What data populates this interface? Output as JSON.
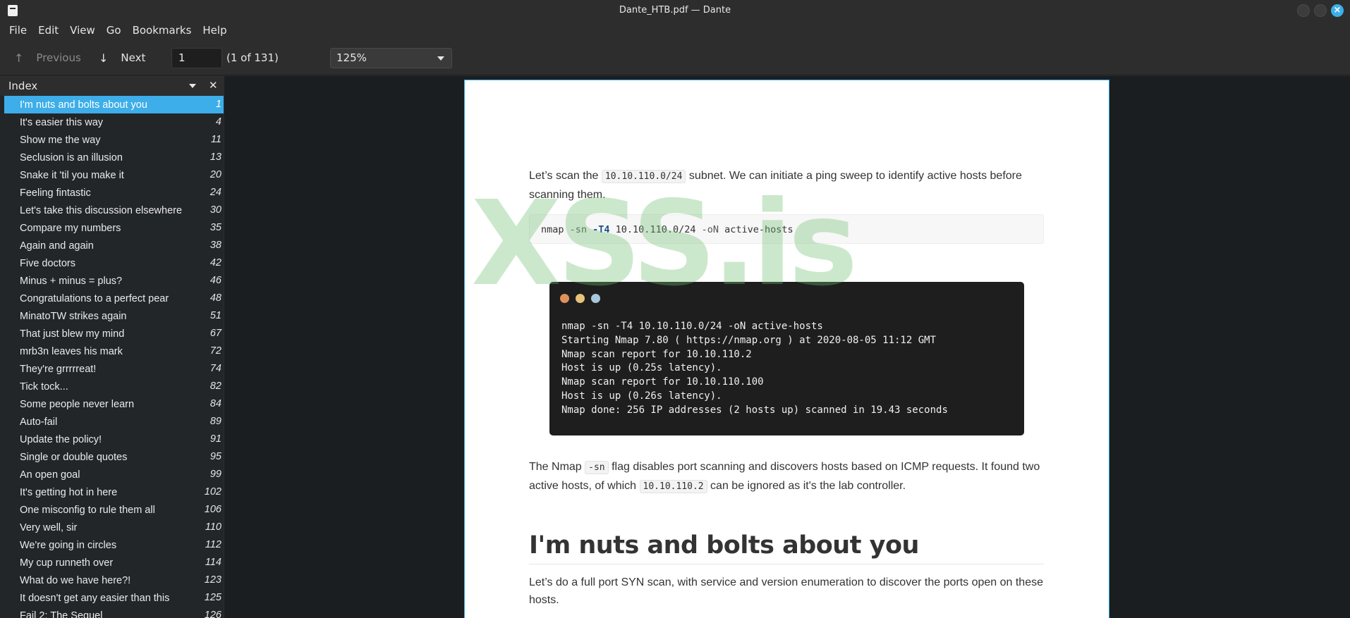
{
  "window": {
    "title": "Dante_HTB.pdf — Dante"
  },
  "menubar": {
    "items": [
      "File",
      "Edit",
      "View",
      "Go",
      "Bookmarks",
      "Help"
    ]
  },
  "toolbar": {
    "previous_label": "Previous",
    "next_label": "Next",
    "page_value": "1",
    "page_count": "(1 of 131)",
    "zoom_value": "125%"
  },
  "sidebar": {
    "title": "Index",
    "items": [
      {
        "label": "I'm nuts and bolts about you",
        "page": "1"
      },
      {
        "label": "It's easier this way",
        "page": "4"
      },
      {
        "label": "Show me the way",
        "page": "11"
      },
      {
        "label": "Seclusion is an illusion",
        "page": "13"
      },
      {
        "label": "Snake it 'til you make it",
        "page": "20"
      },
      {
        "label": "Feeling fintastic",
        "page": "24"
      },
      {
        "label": "Let's take this discussion elsewhere",
        "page": "30"
      },
      {
        "label": "Compare my numbers",
        "page": "35"
      },
      {
        "label": "Again and again",
        "page": "38"
      },
      {
        "label": "Five doctors",
        "page": "42"
      },
      {
        "label": "Minus + minus = plus?",
        "page": "46"
      },
      {
        "label": "Congratulations to a perfect pear",
        "page": "48"
      },
      {
        "label": "MinatoTW strikes again",
        "page": "51"
      },
      {
        "label": "That just blew my mind",
        "page": "67"
      },
      {
        "label": "mrb3n leaves his mark",
        "page": "72"
      },
      {
        "label": "They're grrrrreat!",
        "page": "74"
      },
      {
        "label": "Tick tock...",
        "page": "82"
      },
      {
        "label": "Some people never learn",
        "page": "84"
      },
      {
        "label": "Auto-fail",
        "page": "89"
      },
      {
        "label": "Update the policy!",
        "page": "91"
      },
      {
        "label": "Single or double quotes",
        "page": "95"
      },
      {
        "label": "An open goal",
        "page": "99"
      },
      {
        "label": "It's getting hot in here",
        "page": "102"
      },
      {
        "label": "One misconfig to rule them all",
        "page": "106"
      },
      {
        "label": "Very well, sir",
        "page": "110"
      },
      {
        "label": "We're going in circles",
        "page": "112"
      },
      {
        "label": "My cup runneth over",
        "page": "114"
      },
      {
        "label": "What do we have here?!",
        "page": "123"
      },
      {
        "label": "It doesn't get any easier than this",
        "page": "125"
      },
      {
        "label": "Fail 2: The Sequel",
        "page": "126"
      }
    ]
  },
  "document": {
    "watermark": "XSS.is",
    "para1_a": "Let’s scan the ",
    "para1_code": "10.10.110.0/24",
    "para1_b": " subnet. We can initiate a ping sweep to identify active hosts before scanning them.",
    "cmd_nmap": "nmap ",
    "cmd_sn": "-sn ",
    "cmd_t4": "-T4 ",
    "cmd_subnet": "10.10.110.0/24 ",
    "cmd_on": "-oN ",
    "cmd_out": "active-hosts",
    "terminal_lines": [
      "nmap -sn -T4 10.10.110.0/24 -oN active-hosts",
      "Starting Nmap 7.80 ( https://nmap.org ) at 2020-08-05 11:12 GMT",
      "Nmap scan report for 10.10.110.2",
      "Host is up (0.25s latency).",
      "Nmap scan report for 10.10.110.100",
      "Host is up (0.26s latency).",
      "Nmap done: 256 IP addresses (2 hosts up) scanned in 19.43 seconds"
    ],
    "terminal_dot_colors": [
      "#e0915a",
      "#e6c27a",
      "#a8c6dc"
    ],
    "para2_a": "The Nmap ",
    "para2_code1": "-sn",
    "para2_b": " flag disables port scanning and discovers hosts based on ICMP requests. It found two active hosts, of which ",
    "para2_code2": "10.10.110.2",
    "para2_c": " can be ignored as it's the lab controller.",
    "heading": "I'm nuts and bolts about you",
    "para3": "Let’s do a full port SYN scan, with service and version enumeration to discover the ports open on these hosts."
  },
  "colors": {
    "accent": "#3daee9",
    "watermark": "#6ebe6e"
  }
}
